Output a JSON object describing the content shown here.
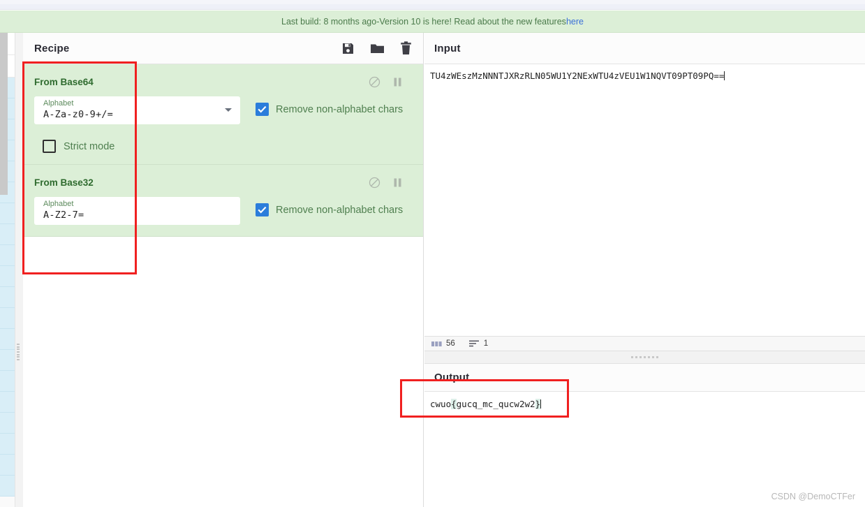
{
  "banner": {
    "prefix": "Last build: 8 months ago",
    "separator": " - ",
    "middle": "Version 10 is here! Read about the new features ",
    "link": "here"
  },
  "recipe": {
    "title": "Recipe",
    "toolbar": {
      "save": "save-icon",
      "load": "folder-icon",
      "clear": "trash-icon"
    },
    "operations": [
      {
        "name": "From Base64",
        "alphabet_label": "Alphabet",
        "alphabet_value": "A-Za-z0-9+/=",
        "remove_chars_label": "Remove non-alphabet chars",
        "remove_chars_checked": "true",
        "strict_label": "Strict mode",
        "strict_checked": "false",
        "disable_icon": "disable-icon",
        "breakpoint_icon": "pause-icon"
      },
      {
        "name": "From Base32",
        "alphabet_label": "Alphabet",
        "alphabet_value": "A-Z2-7=",
        "remove_chars_label": "Remove non-alphabet chars",
        "remove_chars_checked": "true",
        "disable_icon": "disable-icon",
        "breakpoint_icon": "pause-icon"
      }
    ]
  },
  "input": {
    "title": "Input",
    "value": "TU4zWEszMzNNNTJXRzRLN05WU1Y2NExWTU4zVEU1W1NQVT09PT09PQ==",
    "status": {
      "length_icon": "abc-icon",
      "length": "56",
      "lines_icon": "lines-icon",
      "lines": "1"
    }
  },
  "output": {
    "title": "Output",
    "value_prefix": "cwuo",
    "value_highlight_open": "{",
    "value_middle": "gucq_mc_qucw2w2",
    "value_highlight_close": "}",
    "full_value": "cwuo{gucq_mc_qucw2w2}"
  },
  "watermark": "CSDN @DemoCTFer",
  "colors": {
    "recipe_green": "#dcefd7",
    "op_title_green": "#2f6b2f",
    "checkbox_blue": "#2b7ddb",
    "annotation_red": "#f02020",
    "link_blue": "#3a6fd8"
  }
}
